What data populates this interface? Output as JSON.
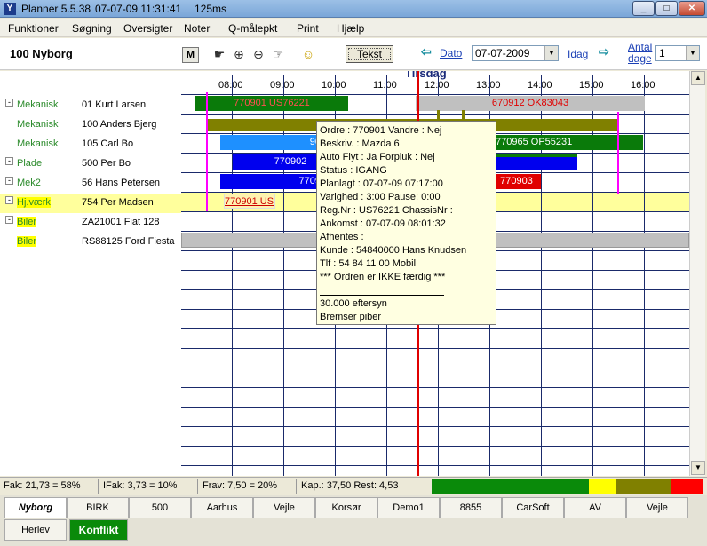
{
  "window": {
    "title": "Planner 5.5.38",
    "datetime": "07-07-09 11:31:41",
    "duration": "125ms"
  },
  "menu": [
    "Funktioner",
    "Søgning",
    "Oversigter",
    "Noter",
    "Q-målepkt",
    "Print",
    "Hjælp"
  ],
  "toolbar": {
    "title": "100  Nyborg",
    "m_label": "M",
    "tekst_label": "Tekst",
    "dato_label": "Dato",
    "date_value": "07-07-2009",
    "idag_label": "Idag",
    "antal_label_1": "Antal",
    "antal_label_2": "dage",
    "antal_value": "1"
  },
  "timeline": {
    "day": "Tirsdag",
    "hours": [
      "08:00",
      "09:00",
      "10:00",
      "11:00",
      "12:00",
      "13:00",
      "14:00",
      "15:00",
      "16:00"
    ]
  },
  "resources": [
    {
      "category": "Mekanisk",
      "number": "01  Kurt Larsen",
      "expander": true
    },
    {
      "category": "Mekanisk",
      "number": "100  Anders Bjerg",
      "expander": false
    },
    {
      "category": "Mekanisk",
      "number": "105  Carl Bo",
      "expander": false
    },
    {
      "category": "Plade",
      "number": "500  Per Bo",
      "expander": true
    },
    {
      "category": "Mek2",
      "number": "56  Hans Petersen",
      "expander": true
    },
    {
      "category": "Hj.værk",
      "number": "754  Per Madsen",
      "expander": true
    },
    {
      "category": "Biler",
      "number": "ZA21001  Fiat 128",
      "expander": true
    },
    {
      "category": "Biler",
      "number": "RS88125  Ford Fiesta",
      "expander": false
    }
  ],
  "bars": {
    "b1": "770901 US76221",
    "b2": "670912 OK83043",
    "b4a": "90",
    "b4b": "770965 OP55231",
    "b5": "770902",
    "b6a": "7709",
    "b6b": "770903",
    "b7": "770901 US7"
  },
  "tooltip": [
    "Ordre       :  770901 Vandre     :  Nej",
    "Beskriv.    :  Mazda 6",
    "Auto Flyt   :  Ja      Forpluk : Nej",
    "Status       :  IGANG",
    "Planlagt    :  07-07-09 07:17:00",
    "Varighed   :  3:00   Pause: 0:00",
    "Reg.Nr      :  US76221   ChassisNr :",
    "Ankomst   :  07-07-09 08:01:32",
    "Afhentes   :",
    "Kunde       :  54840000 Hans Knudsen",
    "Tlf            :  54 84 11 00 Mobil",
    "*** Ordren er IKKE færdig ***",
    "30.000 eftersyn",
    "Bremser piber"
  ],
  "status": {
    "fak": "Fak: 21,73 = 58%",
    "ifak": "IFak: 3,73 = 10%",
    "frav": "Frav: 7,50 = 20%",
    "kap": "Kap.: 37,50 Rest: 4,53"
  },
  "tabs_row1": [
    "Nyborg",
    "BIRK",
    "500",
    "Aarhus",
    "Vejle",
    "Korsør",
    "Demo1",
    "8855",
    "CarSoft",
    "AV",
    "Vejle"
  ],
  "tabs_row2": [
    "Herlev",
    "Konflikt"
  ],
  "colors": {
    "green_bar": "#0a7a0a",
    "blue_bar": "#0000ee",
    "olive_bar": "#808000",
    "red_bar": "#e00000",
    "now_line": "#e00000",
    "marker": "#ff00ff"
  }
}
